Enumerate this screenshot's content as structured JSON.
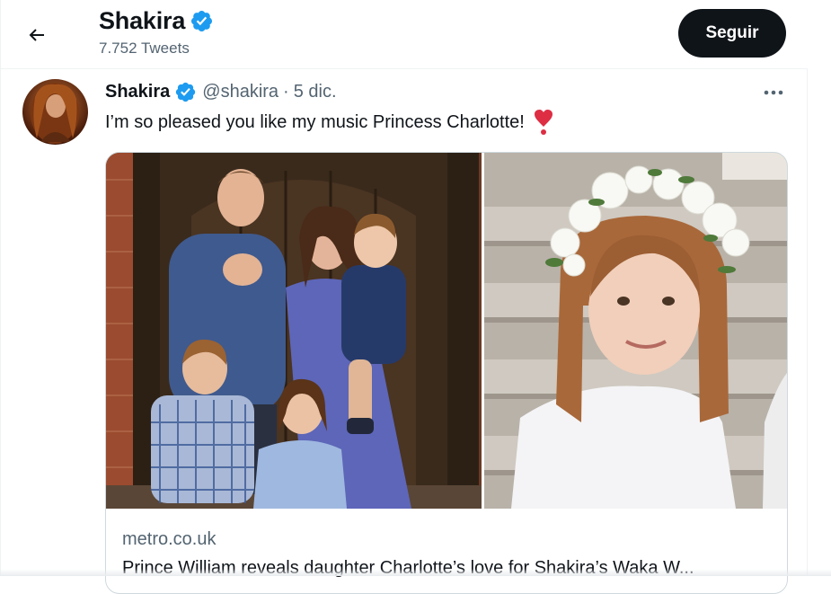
{
  "header": {
    "name": "Shakira",
    "tweet_count": "7.752 Tweets",
    "follow_label": "Seguir"
  },
  "tweet": {
    "name": "Shakira",
    "handle": "@shakira",
    "separator": "·",
    "date": "5 dic.",
    "text": "I’m so pleased you like my music Princess Charlotte!",
    "card": {
      "domain": "metro.co.uk",
      "title": "Prince William reveals daughter Charlotte’s love for Shakira’s Waka W..."
    }
  },
  "icons": {
    "back": "arrow-left-icon",
    "verified": "verified-badge-icon",
    "more": "more-dots-icon",
    "emoji": "heart-exclamation-emoji"
  },
  "colors": {
    "verified_blue": "#1d9bf0",
    "text_primary": "#0f1419",
    "text_secondary": "#536471",
    "follow_button_bg": "#0f1419",
    "border": "#cfd9de"
  }
}
